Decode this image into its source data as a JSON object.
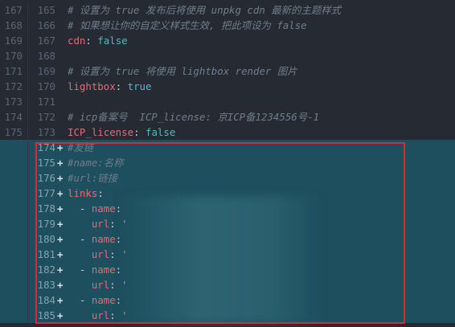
{
  "lines": [
    {
      "old": "167",
      "new": "165",
      "type": "ctx",
      "kind": "comment",
      "text": "# 设置为 true 发布后将使用 unpkg cdn 最新的主题样式"
    },
    {
      "old": "168",
      "new": "166",
      "type": "ctx",
      "kind": "comment",
      "text": "# 如果想让你的自定义样式生效, 把此项设为 false"
    },
    {
      "old": "169",
      "new": "167",
      "type": "ctx",
      "kind": "kv",
      "key": "cdn",
      "sep": ": ",
      "value": "false"
    },
    {
      "old": "170",
      "new": "168",
      "type": "ctx",
      "kind": "blank"
    },
    {
      "old": "171",
      "new": "169",
      "type": "ctx",
      "kind": "comment",
      "text": "# 设置为 true 将使用 lightbox render 图片"
    },
    {
      "old": "172",
      "new": "170",
      "type": "ctx",
      "kind": "kv",
      "key": "lightbox",
      "sep": ": ",
      "value": "true"
    },
    {
      "old": "173",
      "new": "171",
      "type": "ctx",
      "kind": "blank"
    },
    {
      "old": "174",
      "new": "172",
      "type": "ctx",
      "kind": "comment",
      "text": "# icp备案号  ICP_license: 京ICP备1234556号-1"
    },
    {
      "old": "175",
      "new": "173",
      "type": "ctx",
      "kind": "kv",
      "key": "ICP_license",
      "sep": ": ",
      "value": "false"
    },
    {
      "old": "",
      "new": "174",
      "type": "add",
      "sign": "+",
      "kind": "comment",
      "text": "#友链"
    },
    {
      "old": "",
      "new": "175",
      "type": "add",
      "sign": "+",
      "kind": "comment",
      "text": "#name:名称"
    },
    {
      "old": "",
      "new": "176",
      "type": "add",
      "sign": "+",
      "kind": "comment",
      "text": "#url:链接"
    },
    {
      "old": "",
      "new": "177",
      "type": "add",
      "sign": "+",
      "kind": "kv",
      "key": "links",
      "sep": ":",
      "value": ""
    },
    {
      "old": "",
      "new": "178",
      "type": "add",
      "sign": "+",
      "kind": "list",
      "indent": "  ",
      "dash": "- ",
      "key": "name",
      "sep": ": ",
      "value": ""
    },
    {
      "old": "",
      "new": "179",
      "type": "add",
      "sign": "+",
      "kind": "list",
      "indent": "    ",
      "dash": "",
      "key": "url",
      "sep": ": ",
      "value": "'"
    },
    {
      "old": "",
      "new": "180",
      "type": "add",
      "sign": "+",
      "kind": "list",
      "indent": "  ",
      "dash": "- ",
      "key": "name",
      "sep": ": ",
      "value": ""
    },
    {
      "old": "",
      "new": "181",
      "type": "add",
      "sign": "+",
      "kind": "list",
      "indent": "    ",
      "dash": "",
      "key": "url",
      "sep": ": ",
      "value": "'"
    },
    {
      "old": "",
      "new": "182",
      "type": "add",
      "sign": "+",
      "kind": "list",
      "indent": "  ",
      "dash": "- ",
      "key": "name",
      "sep": ": ",
      "value": ""
    },
    {
      "old": "",
      "new": "183",
      "type": "add",
      "sign": "+",
      "kind": "list",
      "indent": "    ",
      "dash": "",
      "key": "url",
      "sep": ": ",
      "value": "'"
    },
    {
      "old": "",
      "new": "184",
      "type": "add",
      "sign": "+",
      "kind": "list",
      "indent": "  ",
      "dash": "- ",
      "key": "name",
      "sep": ": ",
      "value": ""
    },
    {
      "old": "",
      "new": "185",
      "type": "add",
      "sign": "+",
      "kind": "list",
      "indent": "    ",
      "dash": "",
      "key": "url",
      "sep": ": ",
      "value": "'"
    }
  ],
  "colors": {
    "context_bg": "#262b33",
    "added_bg": "#1d4f5e",
    "highlight_border": "#d42d33",
    "key": "#e06c75",
    "bool": "#56b6c2",
    "comment": "#6f7d8a"
  }
}
